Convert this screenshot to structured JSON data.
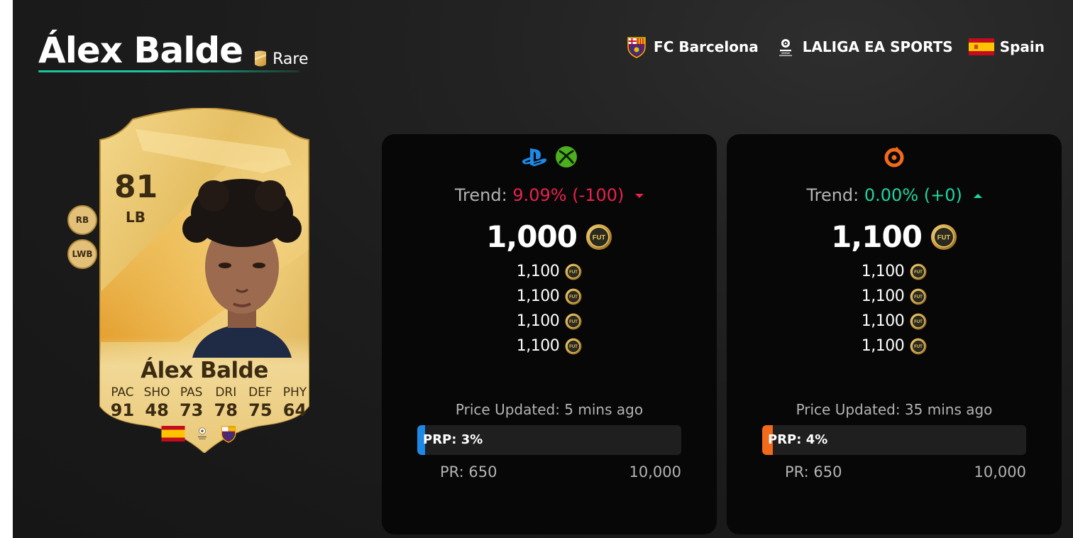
{
  "player": {
    "name": "Álex Balde",
    "rarity": "Rare",
    "club": "FC Barcelona",
    "league": "LALIGA EA SPORTS",
    "nation": "Spain"
  },
  "card": {
    "rating": "81",
    "position": "LB",
    "alt_positions": [
      "RB",
      "LWB"
    ],
    "name": "Álex Balde",
    "stats": [
      {
        "label": "PAC",
        "value": "91"
      },
      {
        "label": "SHO",
        "value": "48"
      },
      {
        "label": "PAS",
        "value": "73"
      },
      {
        "label": "DRI",
        "value": "78"
      },
      {
        "label": "DEF",
        "value": "75"
      },
      {
        "label": "PHY",
        "value": "64"
      }
    ]
  },
  "console": {
    "platform_icons": [
      "playstation-icon",
      "xbox-icon"
    ],
    "trend_label": "Trend:",
    "trend_value": "9.09% (-100)",
    "trend_direction": "down",
    "price": "1,000",
    "lowest": [
      "1,100",
      "1,100",
      "1,100",
      "1,100"
    ],
    "updated": "Price Updated: 5 mins ago",
    "prp_label": "PRP: 3%",
    "prp_percent": 3,
    "prp_color": "#1e88e5",
    "range_min": "PR: 650",
    "range_max": "10,000"
  },
  "pc": {
    "platform_icons": [
      "origin-icon"
    ],
    "trend_label": "Trend:",
    "trend_value": "0.00% (+0)",
    "trend_direction": "up",
    "price": "1,100",
    "lowest": [
      "1,100",
      "1,100",
      "1,100",
      "1,100"
    ],
    "updated": "Price Updated: 35 mins ago",
    "prp_label": "PRP: 4%",
    "prp_percent": 4,
    "prp_color": "#f26a1b",
    "range_min": "PR: 650",
    "range_max": "10,000"
  },
  "colors": {
    "accent": "#19c59a",
    "trend_down": "#e8224f",
    "trend_up": "#1fd6a0",
    "card_gold": "#e9c877"
  }
}
